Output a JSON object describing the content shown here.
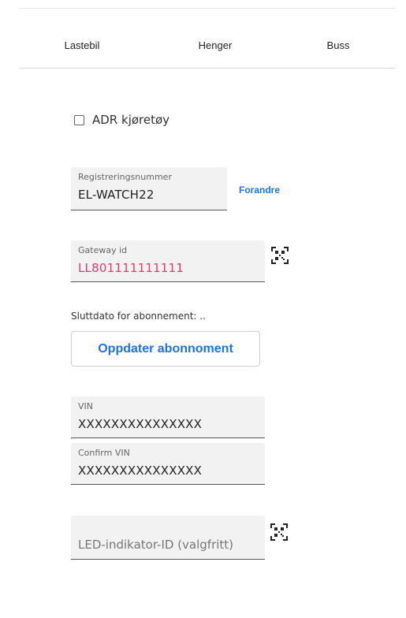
{
  "tabs": [
    {
      "label": "Lastebil"
    },
    {
      "label": "Henger"
    },
    {
      "label": "Buss"
    }
  ],
  "adr": {
    "label": "ADR kjøretøy",
    "checked": false
  },
  "registration": {
    "label": "Registreringsnummer",
    "value": "EL-WATCH22",
    "change_label": "Forandre"
  },
  "gateway": {
    "label": "Gateway id",
    "value": "LL801111111111",
    "value_color": "#e23a6e",
    "scan_icon": "qr-code-icon"
  },
  "subscription": {
    "end_date_label": "Sluttdato for abonnement: ..",
    "update_button": "Oppdater abonnoment"
  },
  "vin": {
    "label": "VIN",
    "value": "XXXXXXXXXXXXXXX"
  },
  "confirm_vin": {
    "label": "Confirm VIN",
    "value": "XXXXXXXXXXXXXXX"
  },
  "led": {
    "placeholder": "LED-indikator-ID (valgfritt)",
    "scan_icon": "qr-code-icon"
  },
  "colors": {
    "accent": "#1a73e8",
    "error_value": "#e23a6e",
    "field_bg": "#f2f2f2"
  }
}
